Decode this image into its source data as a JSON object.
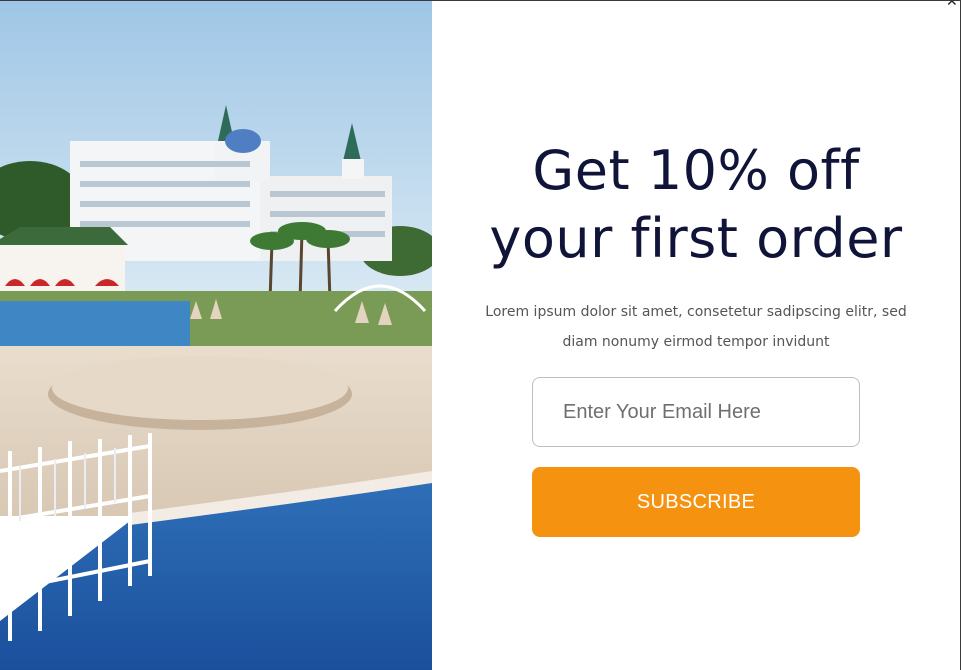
{
  "popup": {
    "headline_line1": "Get 10% off",
    "headline_line2": "your first order",
    "description_line1": "Lorem ipsum dolor sit amet, consetetur sadipscing elitr, sed",
    "description_line2": "diam nonumy eirmod tempor invidunt",
    "email_placeholder": "Enter Your Email Here",
    "email_value": "",
    "subscribe_label": "SUBSCRIBE",
    "close_icon": "close-icon",
    "close_glyph": "✕"
  },
  "colors": {
    "headline": "#101438",
    "button": "#f5920f",
    "button_text": "#ffffff",
    "input_border": "#bdbdbd"
  }
}
